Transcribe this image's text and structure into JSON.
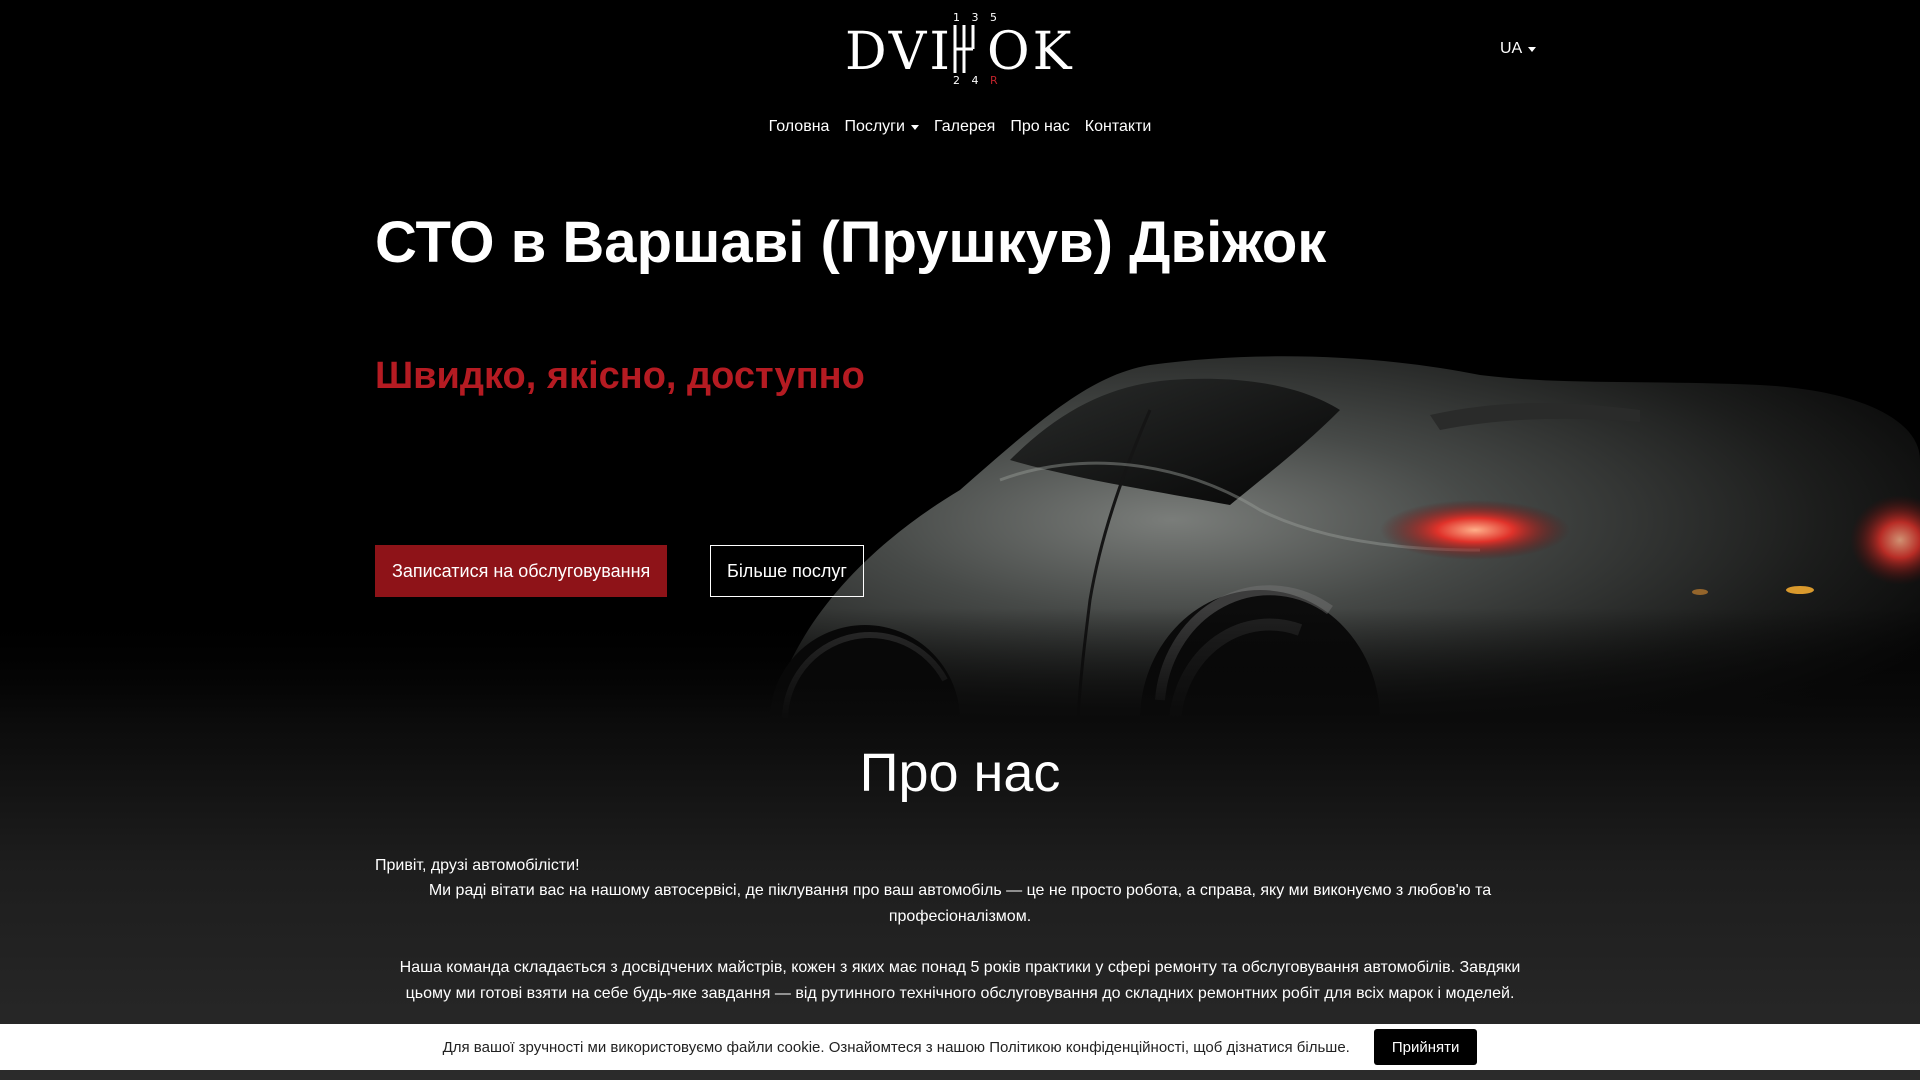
{
  "header": {
    "logo": {
      "left": "DVI",
      "right": "OK",
      "gears_top": "1 3 5",
      "gears_bottom": "2 4",
      "gear_reverse": "R"
    },
    "language": "UA"
  },
  "nav": {
    "items": [
      {
        "label": "Головна"
      },
      {
        "label": "Послуги",
        "dropdown": true
      },
      {
        "label": "Галерея"
      },
      {
        "label": "Про нас"
      },
      {
        "label": "Контакти"
      }
    ]
  },
  "hero": {
    "title": "СТО в Варшаві (Прушкув) Двіжок",
    "subtitle": "Швидко, якісно, доступно",
    "primary_button": "Записатися на обслуговування",
    "secondary_button": "Більше послуг"
  },
  "about": {
    "title": "Про нас",
    "greeting": "Привіт, друзі автомобілісти!",
    "paragraph1": "Ми раді вітати вас на нашому автосервісі, де піклування про ваш автомобіль — це не просто робота, а справа, яку ми виконуємо з любов'ю та професіоналізмом.",
    "paragraph2": "Наша команда складається з досвідчених майстрів, кожен з яких має понад 5 років практики у сфері ремонту та обслуговування автомобілів. Завдяки цьому ми готові взяти на себе будь-яке завдання — від рутинного технічного обслуговування до складних ремонтних робіт для всіх марок і моделей."
  },
  "cookie": {
    "text": "Для вашої зручності ми використовуємо файли cookie. Ознайомтеся з нашою Політикою конфіденційності, щоб дізнатися більше.",
    "accept": "Прийняти"
  },
  "colors": {
    "accent_red": "#b51b22",
    "button_red": "#8e1318",
    "background": "#000000"
  }
}
